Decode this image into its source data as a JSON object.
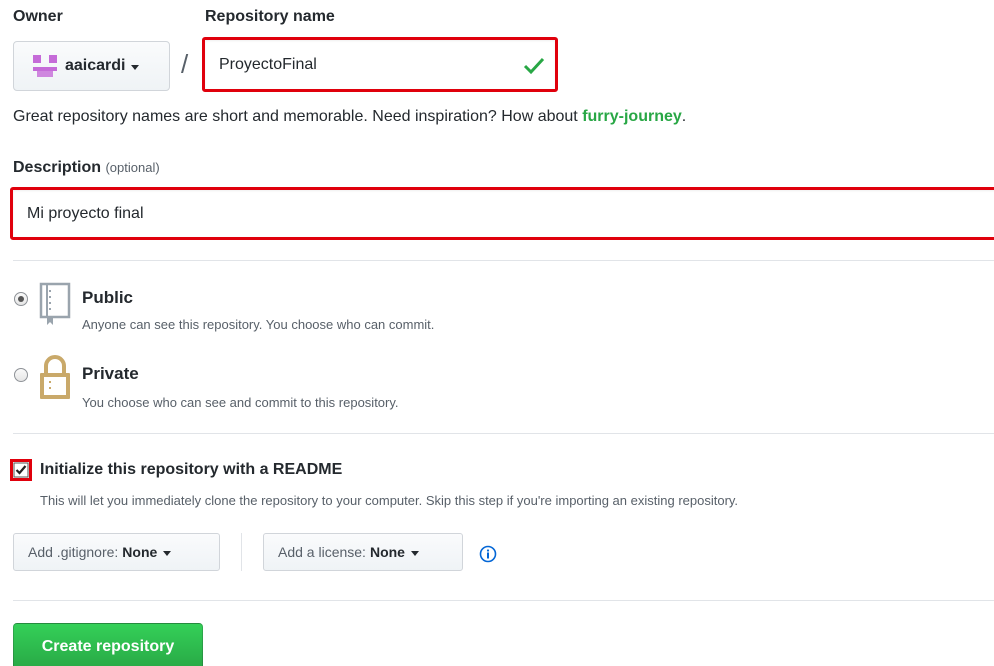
{
  "owner": {
    "label": "Owner",
    "value": "aaicardi"
  },
  "repository": {
    "label": "Repository name",
    "value": "ProyectoFinal",
    "hint_prefix": "Great repository names are short and memorable. Need inspiration? How about ",
    "hint_suggestion": "furry-journey",
    "hint_suffix": "."
  },
  "separator": "/",
  "description": {
    "label": "Description",
    "optional": "(optional)",
    "value": "Mi proyecto final"
  },
  "visibility": {
    "public": {
      "title": "Public",
      "desc": "Anyone can see this repository. You choose who can commit.",
      "selected": true
    },
    "private": {
      "title": "Private",
      "desc": "You choose who can see and commit to this repository.",
      "selected": false
    }
  },
  "readme": {
    "title": "Initialize this repository with a README",
    "desc": "This will let you immediately clone the repository to your computer. Skip this step if you're importing an existing repository.",
    "checked": true
  },
  "gitignore": {
    "label": "Add .gitignore:",
    "value": "None"
  },
  "license": {
    "label": "Add a license:",
    "value": "None"
  },
  "create_button": "Create repository",
  "colors": {
    "highlight": "#e0000c",
    "success": "#28a745",
    "info": "#0366d6",
    "avatar": "#c56bd8",
    "repo_icon": "#9aa4ad",
    "lock_icon": "#c9a96a"
  }
}
